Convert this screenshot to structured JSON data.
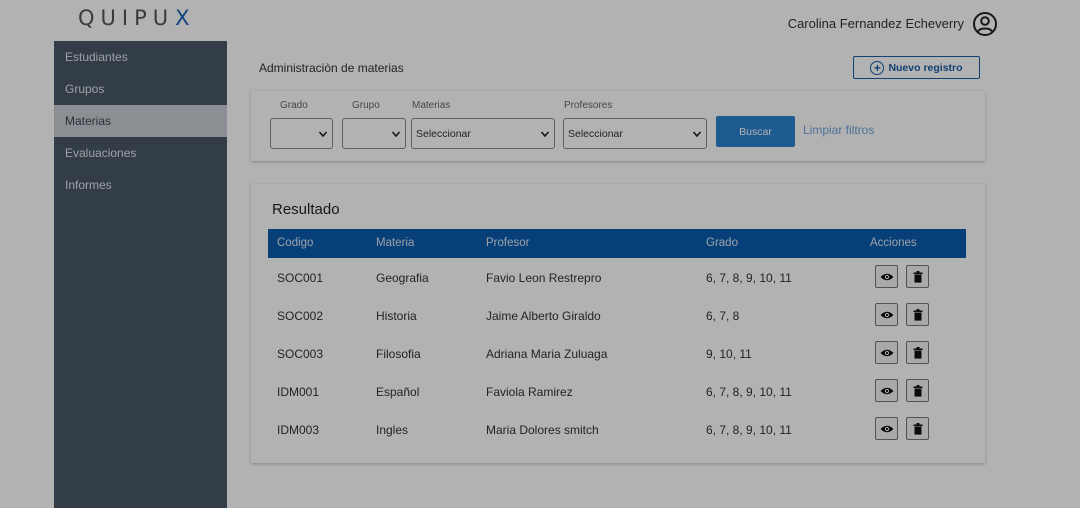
{
  "header": {
    "logo_text": "QUIPU",
    "logo_x": "X",
    "user_name": "Carolina Fernandez Echeverry",
    "user_icon": "account-circle-icon"
  },
  "sidebar": {
    "items": [
      {
        "label": "Estudiantes",
        "active": false
      },
      {
        "label": "Grupos",
        "active": false
      },
      {
        "label": "Materias",
        "active": true
      },
      {
        "label": "Evaluaciones",
        "active": false
      },
      {
        "label": "Informes",
        "active": false
      }
    ]
  },
  "main": {
    "title": "Administraciòn de materias",
    "new_button": "Nuevo registro"
  },
  "filters": {
    "grado_label": "Grado",
    "grupo_label": "Grupo",
    "materias_label": "Materias",
    "materias_value": "Seleccionar",
    "profesores_label": "Profesores",
    "profesores_value": "Seleccionar",
    "search_button": "Buscar",
    "clear_link": "Limpiar filtros"
  },
  "results": {
    "title": "Resultado",
    "columns": [
      "Codigo",
      "Materia",
      "Profesor",
      "Grado",
      "Acciones"
    ],
    "rows": [
      {
        "codigo": "SOC001",
        "materia": "Geografia",
        "profesor": "Favio Leon Restrepro",
        "grado": "6, 7, 8, 9, 10, 11"
      },
      {
        "codigo": "SOC002",
        "materia": "Historia",
        "profesor": "Jaime Alberto Giraldo",
        "grado": "6, 7, 8"
      },
      {
        "codigo": "SOC003",
        "materia": "Filosofia",
        "profesor": "Adriana Maria Zuluaga",
        "grado": "9, 10, 11"
      },
      {
        "codigo": "IDM001",
        "materia": "Español",
        "profesor": "Faviola Ramirez",
        "grado": "6, 7, 8, 9, 10, 11"
      },
      {
        "codigo": "IDM003",
        "materia": "Ingles",
        "profesor": "Maria Dolores smitch",
        "grado": "6, 7, 8, 9, 10, 11"
      }
    ]
  },
  "colors": {
    "sidebar": "#4a5868",
    "table_header": "#0b5cae",
    "primary_button": "#2b83d0",
    "overlay": "rgba(0,0,0,0.3)"
  }
}
